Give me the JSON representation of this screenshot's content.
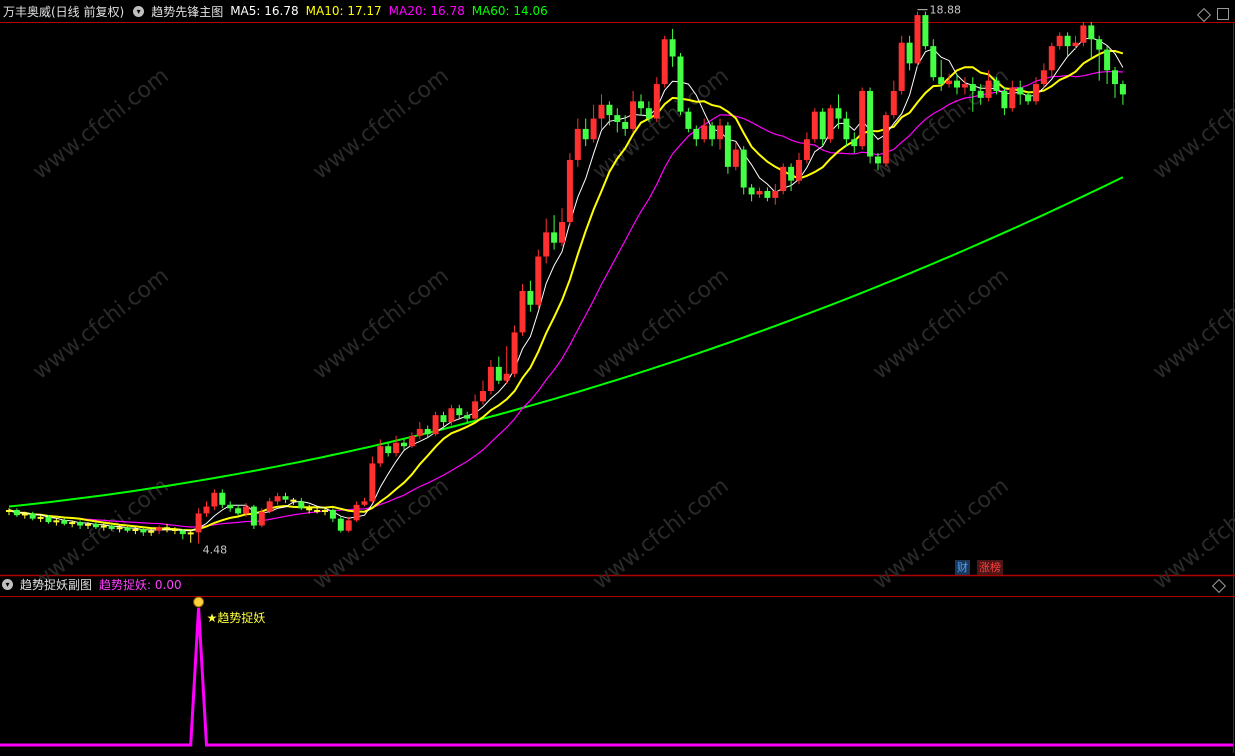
{
  "main_panel": {
    "stock_title": "万丰奥威(日线 前复权)",
    "indicator_name": "趋势先锋主图",
    "ma_readouts": [
      {
        "label": "MA5: 16.78",
        "color": "#ffffff"
      },
      {
        "label": "MA10: 17.17",
        "color": "#ffff00"
      },
      {
        "label": "MA20: 16.78",
        "color": "#ff00ff"
      },
      {
        "label": "MA60: 14.06",
        "color": "#00ff00"
      }
    ],
    "high_label": "18.88",
    "low_label": "4.48",
    "badges": [
      {
        "text": "财",
        "color": "#4aa0ff"
      },
      {
        "text": "涨榜",
        "color": "#ff4040"
      }
    ]
  },
  "sub_panel": {
    "indicator_name": "趋势捉妖副图",
    "readout": "趋势捉妖: 0.00",
    "signal_label": "★趋势捉妖",
    "signal_icon": "money-bag-icon"
  },
  "watermark": "www.cfchi.com",
  "colors": {
    "up": "#ff3030",
    "down": "#44ff44",
    "doji": "#ffff33",
    "ma5": "#ffffff",
    "ma10": "#ffff00",
    "ma20": "#ff00ff",
    "ma60": "#00ff00",
    "signal": "#ff00ff",
    "divider": "#b00000"
  },
  "chart_data": {
    "type": "candlestick",
    "price_range": [
      4.0,
      19.6
    ],
    "candles": [
      [
        5.4,
        5.45,
        5.5,
        5.3
      ],
      [
        5.45,
        5.3,
        5.5,
        5.25
      ],
      [
        5.3,
        5.35,
        5.4,
        5.2
      ],
      [
        5.35,
        5.2,
        5.4,
        5.15
      ],
      [
        5.2,
        5.25,
        5.3,
        5.1
      ],
      [
        5.25,
        5.1,
        5.3,
        5.05
      ],
      [
        5.1,
        5.15,
        5.2,
        5.0
      ],
      [
        5.15,
        5.05,
        5.2,
        5.0
      ],
      [
        5.05,
        5.1,
        5.15,
        4.95
      ],
      [
        5.1,
        5.0,
        5.15,
        4.9
      ],
      [
        5.0,
        5.05,
        5.1,
        4.9
      ],
      [
        5.05,
        4.95,
        5.1,
        4.9
      ],
      [
        4.95,
        5.0,
        5.05,
        4.85
      ],
      [
        5.0,
        4.9,
        5.05,
        4.85
      ],
      [
        4.9,
        4.95,
        5.0,
        4.8
      ],
      [
        4.95,
        4.85,
        5.0,
        4.8
      ],
      [
        4.85,
        4.9,
        4.95,
        4.75
      ],
      [
        4.9,
        4.8,
        4.95,
        4.7
      ],
      [
        4.8,
        4.85,
        4.9,
        4.7
      ],
      [
        4.85,
        4.95,
        5.0,
        4.75
      ],
      [
        4.95,
        4.9,
        5.05,
        4.8
      ],
      [
        4.9,
        4.85,
        4.95,
        4.75
      ],
      [
        4.85,
        4.75,
        4.9,
        4.6
      ],
      [
        4.75,
        4.8,
        4.85,
        4.5
      ],
      [
        4.8,
        5.35,
        5.5,
        4.48
      ],
      [
        5.35,
        5.55,
        5.7,
        5.25
      ],
      [
        5.55,
        5.95,
        6.05,
        5.45
      ],
      [
        5.95,
        5.6,
        6.05,
        5.5
      ],
      [
        5.6,
        5.5,
        5.7,
        5.4
      ],
      [
        5.5,
        5.35,
        5.6,
        5.3
      ],
      [
        5.35,
        5.55,
        5.65,
        5.25
      ],
      [
        5.55,
        5.0,
        5.6,
        4.9
      ],
      [
        5.0,
        5.4,
        5.5,
        4.95
      ],
      [
        5.4,
        5.7,
        5.8,
        5.35
      ],
      [
        5.7,
        5.85,
        5.95,
        5.6
      ],
      [
        5.85,
        5.75,
        5.95,
        5.65
      ],
      [
        5.75,
        5.7,
        5.8,
        5.6
      ],
      [
        5.7,
        5.5,
        5.8,
        5.45
      ],
      [
        5.5,
        5.45,
        5.6,
        5.35
      ],
      [
        5.45,
        5.4,
        5.55,
        5.35
      ],
      [
        5.4,
        5.45,
        5.55,
        5.3
      ],
      [
        5.45,
        5.2,
        5.5,
        5.1
      ],
      [
        5.2,
        4.85,
        5.25,
        4.8
      ],
      [
        4.85,
        5.15,
        5.25,
        4.8
      ],
      [
        5.15,
        5.6,
        5.7,
        5.1
      ],
      [
        5.6,
        5.7,
        5.8,
        5.55
      ],
      [
        5.7,
        6.8,
        7.0,
        5.65
      ],
      [
        6.8,
        7.3,
        7.5,
        6.7
      ],
      [
        7.3,
        7.1,
        7.4,
        7.0
      ],
      [
        7.1,
        7.4,
        7.6,
        7.0
      ],
      [
        7.4,
        7.3,
        7.5,
        7.2
      ],
      [
        7.3,
        7.6,
        7.7,
        7.25
      ],
      [
        7.6,
        7.8,
        8.0,
        7.5
      ],
      [
        7.8,
        7.65,
        7.9,
        7.55
      ],
      [
        7.65,
        8.2,
        8.3,
        7.6
      ],
      [
        8.2,
        8.0,
        8.3,
        7.8
      ],
      [
        8.0,
        8.4,
        8.5,
        7.9
      ],
      [
        8.4,
        8.2,
        8.5,
        8.1
      ],
      [
        8.2,
        8.1,
        8.3,
        8.0
      ],
      [
        8.1,
        8.6,
        8.8,
        8.05
      ],
      [
        8.6,
        8.9,
        9.2,
        8.5
      ],
      [
        8.9,
        9.6,
        9.8,
        8.8
      ],
      [
        9.6,
        9.2,
        9.9,
        9.1
      ],
      [
        9.2,
        9.4,
        10.2,
        9.1
      ],
      [
        9.4,
        10.6,
        10.8,
        9.3
      ],
      [
        10.6,
        11.8,
        12.0,
        10.5
      ],
      [
        11.8,
        11.4,
        12.1,
        11.2
      ],
      [
        11.4,
        12.8,
        13.0,
        11.3
      ],
      [
        12.8,
        13.5,
        13.9,
        12.6
      ],
      [
        13.5,
        13.2,
        14.0,
        13.0
      ],
      [
        13.2,
        13.8,
        14.2,
        13.1
      ],
      [
        13.8,
        15.6,
        15.8,
        13.7
      ],
      [
        15.6,
        16.5,
        16.8,
        15.4
      ],
      [
        16.5,
        16.2,
        16.8,
        16.0
      ],
      [
        16.2,
        16.8,
        17.2,
        16.1
      ],
      [
        16.8,
        17.2,
        17.5,
        16.5
      ],
      [
        17.2,
        16.9,
        17.3,
        16.6
      ],
      [
        16.9,
        16.7,
        17.1,
        16.4
      ],
      [
        16.7,
        16.5,
        16.9,
        16.3
      ],
      [
        16.5,
        17.3,
        17.6,
        16.4
      ],
      [
        17.3,
        17.1,
        17.5,
        16.9
      ],
      [
        17.1,
        16.8,
        17.3,
        16.7
      ],
      [
        16.8,
        17.8,
        18.0,
        16.7
      ],
      [
        17.8,
        19.1,
        19.2,
        17.7
      ],
      [
        19.1,
        18.6,
        19.4,
        18.3
      ],
      [
        18.6,
        17.0,
        18.7,
        16.9
      ],
      [
        17.0,
        16.5,
        17.1,
        16.4
      ],
      [
        16.5,
        16.2,
        16.6,
        16.0
      ],
      [
        16.2,
        16.6,
        16.8,
        16.1
      ],
      [
        16.6,
        16.2,
        16.7,
        16.0
      ],
      [
        16.2,
        16.6,
        16.8,
        15.9
      ],
      [
        16.6,
        15.4,
        16.7,
        15.2
      ],
      [
        15.4,
        15.9,
        16.1,
        15.3
      ],
      [
        15.9,
        14.8,
        16.0,
        14.6
      ],
      [
        14.8,
        14.6,
        14.9,
        14.4
      ],
      [
        14.6,
        14.7,
        14.8,
        14.5
      ],
      [
        14.7,
        14.5,
        14.8,
        14.4
      ],
      [
        14.5,
        14.7,
        14.9,
        14.3
      ],
      [
        14.7,
        15.4,
        15.5,
        14.6
      ],
      [
        15.4,
        15.0,
        15.5,
        14.7
      ],
      [
        15.0,
        15.6,
        15.8,
        14.9
      ],
      [
        15.6,
        16.2,
        16.4,
        15.5
      ],
      [
        16.2,
        17.0,
        17.1,
        16.1
      ],
      [
        17.0,
        16.2,
        17.1,
        16.0
      ],
      [
        16.2,
        17.1,
        17.2,
        16.1
      ],
      [
        17.1,
        16.8,
        17.5,
        16.5
      ],
      [
        16.8,
        16.2,
        17.0,
        16.0
      ],
      [
        16.2,
        16.0,
        16.4,
        15.8
      ],
      [
        16.0,
        17.6,
        17.7,
        15.9
      ],
      [
        17.6,
        15.7,
        17.7,
        15.5
      ],
      [
        15.7,
        15.5,
        15.8,
        15.3
      ],
      [
        15.5,
        16.9,
        17.0,
        15.4
      ],
      [
        16.9,
        17.6,
        17.9,
        16.8
      ],
      [
        17.6,
        19.0,
        19.2,
        17.5
      ],
      [
        19.0,
        18.4,
        19.2,
        18.2
      ],
      [
        18.4,
        19.8,
        19.9,
        18.3
      ],
      [
        19.8,
        18.9,
        19.9,
        18.8
      ],
      [
        18.9,
        18.0,
        19.1,
        17.9
      ],
      [
        18.0,
        17.8,
        18.5,
        17.6
      ],
      [
        17.8,
        17.9,
        18.1,
        17.7
      ],
      [
        17.9,
        17.7,
        18.1,
        17.5
      ],
      [
        17.7,
        17.8,
        18.0,
        17.5
      ],
      [
        17.8,
        17.6,
        18.0,
        17.0
      ],
      [
        17.6,
        17.4,
        17.8,
        17.2
      ],
      [
        17.4,
        17.9,
        18.2,
        17.3
      ],
      [
        17.9,
        17.6,
        18.0,
        17.5
      ],
      [
        17.6,
        17.1,
        17.7,
        16.9
      ],
      [
        17.1,
        17.7,
        17.9,
        17.0
      ],
      [
        17.7,
        17.5,
        17.9,
        17.2
      ],
      [
        17.5,
        17.3,
        17.6,
        17.2
      ],
      [
        17.3,
        17.8,
        18.0,
        17.2
      ],
      [
        17.8,
        18.2,
        18.4,
        17.7
      ],
      [
        18.2,
        18.9,
        19.0,
        18.0
      ],
      [
        18.9,
        19.2,
        19.3,
        18.8
      ],
      [
        19.2,
        18.9,
        19.3,
        18.6
      ],
      [
        18.9,
        19.0,
        19.2,
        18.8
      ],
      [
        19.0,
        19.5,
        19.6,
        18.9
      ],
      [
        19.5,
        19.1,
        19.6,
        18.5
      ],
      [
        19.1,
        18.8,
        19.2,
        17.9
      ],
      [
        18.8,
        18.2,
        18.9,
        17.8
      ],
      [
        18.2,
        17.8,
        18.3,
        17.4
      ],
      [
        17.8,
        17.5,
        17.9,
        17.2
      ]
    ],
    "ma60": {
      "start": 5.55,
      "end": 15.1
    },
    "signal": {
      "values": [
        0,
        0,
        0,
        0,
        0,
        0,
        0,
        0,
        0,
        0,
        0,
        0,
        0,
        0,
        0,
        0,
        0,
        0,
        0,
        0,
        0,
        0,
        0,
        0,
        1,
        0
      ],
      "peak_index": 24
    },
    "sub_range": [
      0,
      1
    ]
  }
}
